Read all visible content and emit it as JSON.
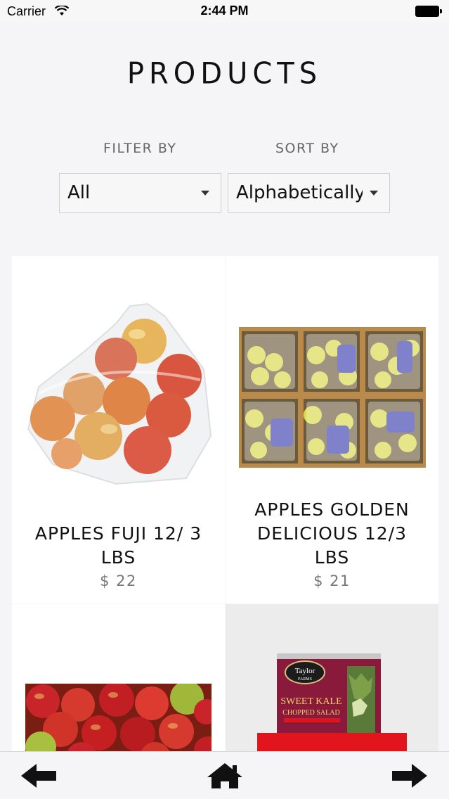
{
  "status_bar": {
    "carrier": "Carrier",
    "time": "2:44 PM"
  },
  "page": {
    "title": "PRODUCTS"
  },
  "filters": {
    "filter_label": "FILTER BY",
    "filter_value": "All",
    "sort_label": "SORT BY",
    "sort_value": "Alphabetically"
  },
  "products": [
    {
      "name": "APPLES FUJI 12/ 3 LBS",
      "price": "$ 22",
      "image": "bag-of-fuji-apples"
    },
    {
      "name": "APPLES GOLDEN DELICIOUS 12/3 LBS",
      "price": "$ 21",
      "image": "boxes-of-golden-apples"
    },
    {
      "name": "",
      "price": "",
      "image": "red-apples-pile"
    },
    {
      "name": "",
      "price": "",
      "image": "taylor-farms-sweet-kale-salad-bag",
      "image_text": [
        "Taylor FARMS",
        "SWEET KALE",
        "CHOPPED SALAD"
      ]
    }
  ],
  "bottom_nav": {
    "back_icon": "arrow-left-icon",
    "home_icon": "home-icon",
    "forward_icon": "arrow-right-icon"
  },
  "colors": {
    "background": "#f5f5f7",
    "card": "#ffffff",
    "accent_red": "#e2151c",
    "text_muted": "#777777"
  }
}
